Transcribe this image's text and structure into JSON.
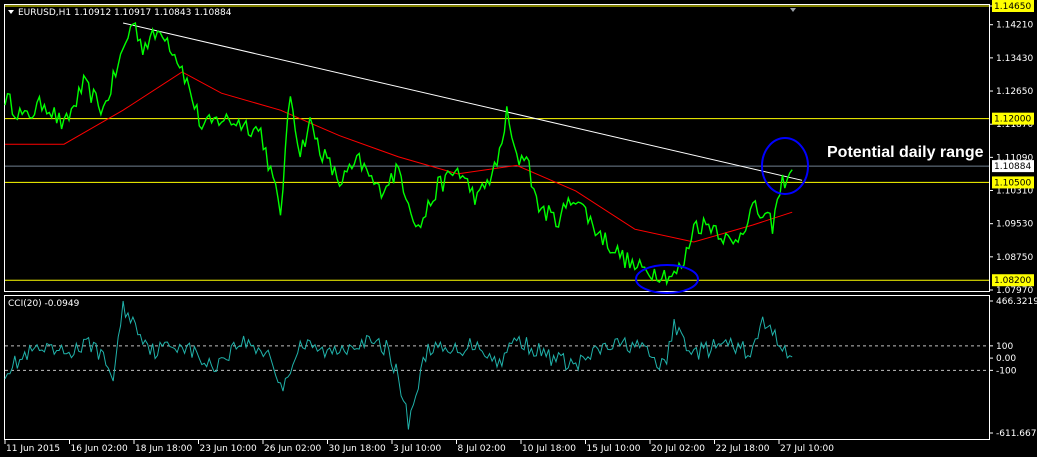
{
  "header": {
    "symbol_line": "EURUSD,H1  1.10912 1.10917 1.10843 1.10884",
    "indicator_line": "CCI(20) -0.0949"
  },
  "annotation": "Potential daily range",
  "colors": {
    "background": "#000000",
    "price": "#00ff00",
    "ma": "#ff0000",
    "trendline": "#ffffff",
    "level": "#ffff00",
    "circle": "#0000ff",
    "cci": "#20b2aa",
    "cci_level": "#c0c0c0",
    "grid_border": "#ffffff"
  },
  "chart_data": [
    {
      "type": "line",
      "title": "EURUSD,H1",
      "ylim": [
        1.0797,
        1.1465
      ],
      "y_ticks": [
        "1.14650",
        "1.14210",
        "1.13430",
        "1.12650",
        "1.11870",
        "1.11090",
        "1.10310",
        "1.09530",
        "1.08750",
        "1.07970"
      ],
      "x_ticks": [
        "11 Jun 2015",
        "16 Jun 02:00",
        "18 Jun 18:00",
        "23 Jun 10:00",
        "26 Jun 02:00",
        "30 Jun 18:00",
        "3 Jul 10:00",
        "8 Jul 02:00",
        "10 Jul 18:00",
        "15 Jul 10:00",
        "20 Jul 02:00",
        "22 Jul 18:00",
        "27 Jul 10:00"
      ],
      "levels": [
        {
          "label": "1.14650",
          "value": 1.1465
        },
        {
          "label": "1.12000",
          "value": 1.12
        },
        {
          "label": "1.10500",
          "value": 1.105
        },
        {
          "label": "1.08200",
          "value": 1.082
        }
      ],
      "current_price": {
        "label": "1.10884",
        "value": 1.10884
      },
      "trendline": {
        "from": [
          0.12,
          1.1425
        ],
        "to": [
          0.81,
          1.1055
        ]
      },
      "series": [
        {
          "kind": "price",
          "x": [
            0.0,
            0.02,
            0.04,
            0.06,
            0.08,
            0.1,
            0.12,
            0.13,
            0.14,
            0.16,
            0.18,
            0.2,
            0.22,
            0.24,
            0.26,
            0.28,
            0.29,
            0.3,
            0.31,
            0.32,
            0.34,
            0.36,
            0.38,
            0.4,
            0.42,
            0.44,
            0.46,
            0.48,
            0.5,
            0.51,
            0.52,
            0.53,
            0.54,
            0.56,
            0.58,
            0.6,
            0.62,
            0.64,
            0.66,
            0.68,
            0.69,
            0.7,
            0.72,
            0.74,
            0.76,
            0.78,
            0.79,
            0.8
          ],
          "values": [
            1.125,
            1.12,
            1.124,
            1.118,
            1.128,
            1.122,
            1.136,
            1.143,
            1.137,
            1.141,
            1.132,
            1.118,
            1.12,
            1.119,
            1.117,
            1.098,
            1.126,
            1.112,
            1.119,
            1.113,
            1.105,
            1.11,
            1.103,
            1.108,
            1.094,
            1.104,
            1.108,
            1.101,
            1.109,
            1.121,
            1.11,
            1.112,
            1.1,
            1.096,
            1.102,
            1.094,
            1.089,
            1.085,
            1.084,
            1.083,
            1.086,
            1.095,
            1.095,
            1.09,
            1.099,
            1.095,
            1.105,
            1.108
          ]
        },
        {
          "kind": "ma",
          "x": [
            0.0,
            0.06,
            0.12,
            0.18,
            0.22,
            0.28,
            0.34,
            0.4,
            0.46,
            0.52,
            0.58,
            0.64,
            0.7,
            0.76,
            0.8
          ],
          "values": [
            1.114,
            1.114,
            1.122,
            1.131,
            1.126,
            1.122,
            1.116,
            1.111,
            1.107,
            1.109,
            1.103,
            1.094,
            1.091,
            1.095,
            1.098
          ]
        }
      ]
    },
    {
      "type": "line",
      "title": "CCI(20)",
      "ylim": [
        -611.6673,
        466.3219
      ],
      "y_ticks": [
        "466.3219",
        "100",
        "0.00",
        "-100",
        "-611.6673"
      ],
      "levels": [
        100,
        -100
      ],
      "series": [
        {
          "name": "CCI(20)",
          "x": [
            0.0,
            0.03,
            0.06,
            0.09,
            0.11,
            0.12,
            0.15,
            0.18,
            0.21,
            0.24,
            0.27,
            0.28,
            0.3,
            0.33,
            0.36,
            0.39,
            0.4,
            0.41,
            0.43,
            0.45,
            0.48,
            0.5,
            0.52,
            0.55,
            0.58,
            0.61,
            0.64,
            0.67,
            0.68,
            0.7,
            0.73,
            0.76,
            0.77,
            0.8
          ],
          "values": [
            -100,
            60,
            40,
            120,
            -150,
            420,
            60,
            120,
            -80,
            140,
            30,
            -260,
            110,
            40,
            140,
            80,
            -180,
            -520,
            100,
            40,
            130,
            -50,
            160,
            20,
            -60,
            90,
            120,
            -80,
            260,
            40,
            110,
            50,
            300,
            10
          ]
        }
      ]
    }
  ]
}
